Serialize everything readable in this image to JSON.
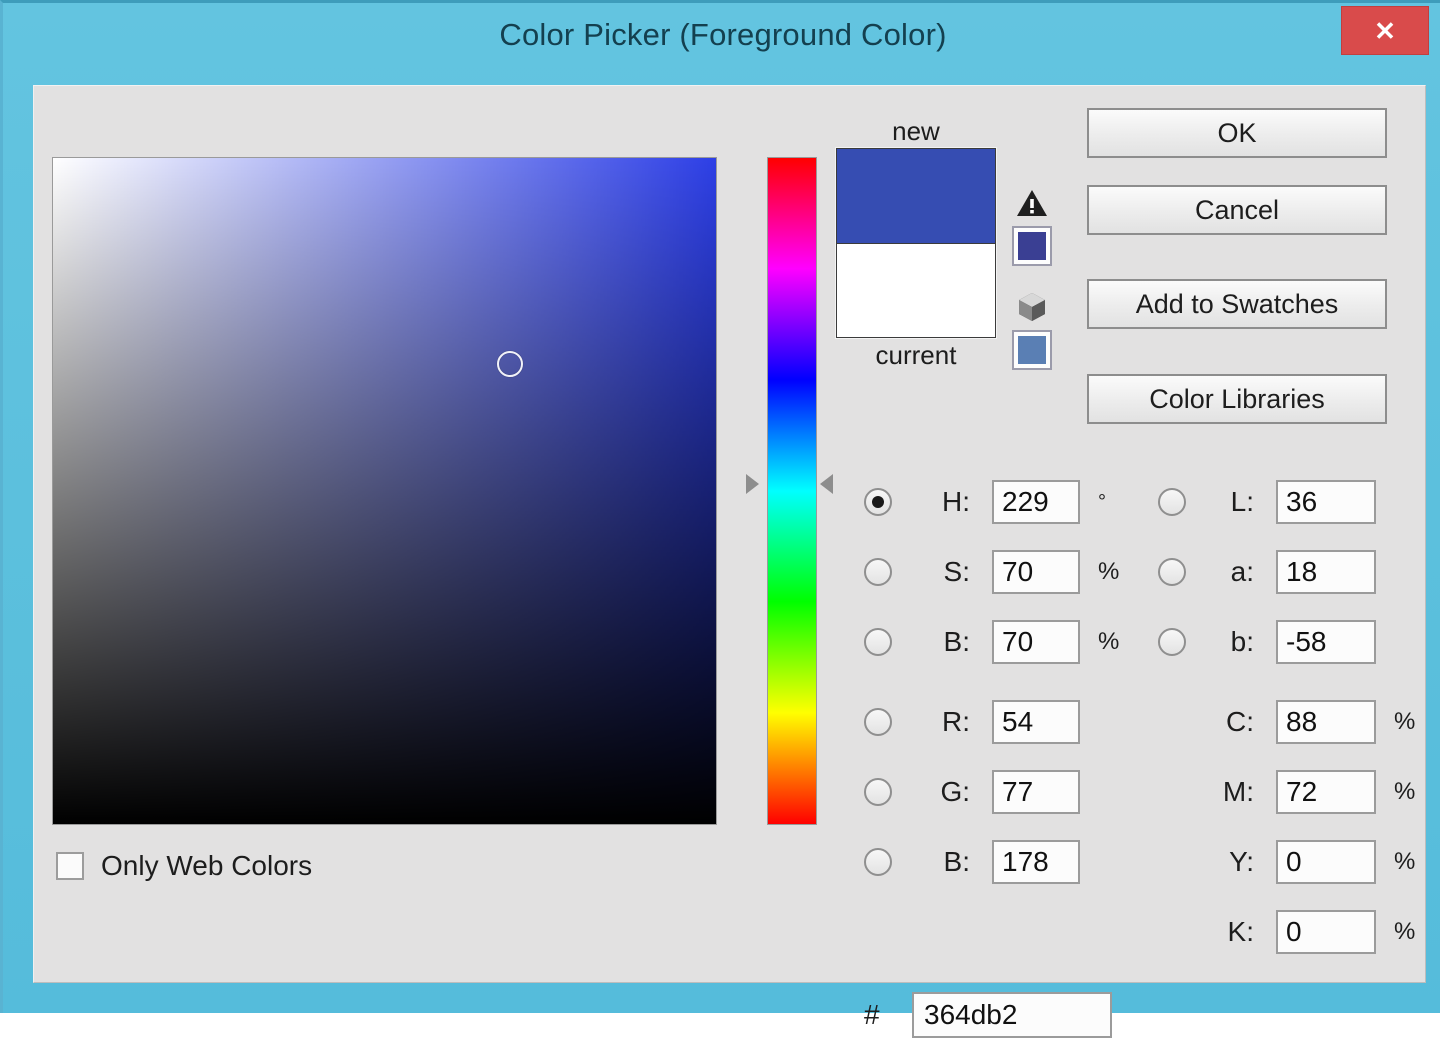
{
  "window": {
    "title": "Color Picker (Foreground Color)",
    "close_label": "✕",
    "frame_color": "#5cc0dd",
    "body_color": "#e2e1e1"
  },
  "picker": {
    "field": {
      "hue_color": "#2d3fe6",
      "marker_x_pct": 69,
      "marker_y_pct": 31
    },
    "hue_slider": {
      "thumb_y_pct": 49
    },
    "only_web_colors": {
      "label": "Only Web Colors",
      "checked": false
    }
  },
  "preview": {
    "new_label": "new",
    "current_label": "current",
    "new_color": "#364db2",
    "current_color": "#ffffff",
    "gamut_warning_icon": "warning-triangle-icon",
    "gamut_proof_color": "#3a3f93",
    "websafe_icon": "cube-icon",
    "websafe_proof_color": "#5a7fb4"
  },
  "buttons": {
    "ok": "OK",
    "cancel": "Cancel",
    "add_to_swatches": "Add to Swatches",
    "color_libraries": "Color Libraries"
  },
  "values": {
    "hsb": [
      {
        "key": "H",
        "label": "H:",
        "value": "229",
        "unit": "°",
        "selected": true
      },
      {
        "key": "S",
        "label": "S:",
        "value": "70",
        "unit": "%",
        "selected": false
      },
      {
        "key": "B",
        "label": "B:",
        "value": "70",
        "unit": "%",
        "selected": false
      }
    ],
    "rgb": [
      {
        "key": "R",
        "label": "R:",
        "value": "54",
        "unit": "",
        "selected": false
      },
      {
        "key": "G",
        "label": "G:",
        "value": "77",
        "unit": "",
        "selected": false
      },
      {
        "key": "B",
        "label": "B:",
        "value": "178",
        "unit": "",
        "selected": false
      }
    ],
    "lab": [
      {
        "key": "L",
        "label": "L:",
        "value": "36",
        "unit": "",
        "selected": false
      },
      {
        "key": "a",
        "label": "a:",
        "value": "18",
        "unit": "",
        "selected": false
      },
      {
        "key": "b",
        "label": "b:",
        "value": "-58",
        "unit": "",
        "selected": false
      }
    ],
    "cmyk": [
      {
        "key": "C",
        "label": "C:",
        "value": "88",
        "unit": "%"
      },
      {
        "key": "M",
        "label": "M:",
        "value": "72",
        "unit": "%"
      },
      {
        "key": "Y",
        "label": "Y:",
        "value": "0",
        "unit": "%"
      },
      {
        "key": "K",
        "label": "K:",
        "value": "0",
        "unit": "%"
      }
    ],
    "hex": {
      "sign": "#",
      "value": "364db2"
    }
  }
}
